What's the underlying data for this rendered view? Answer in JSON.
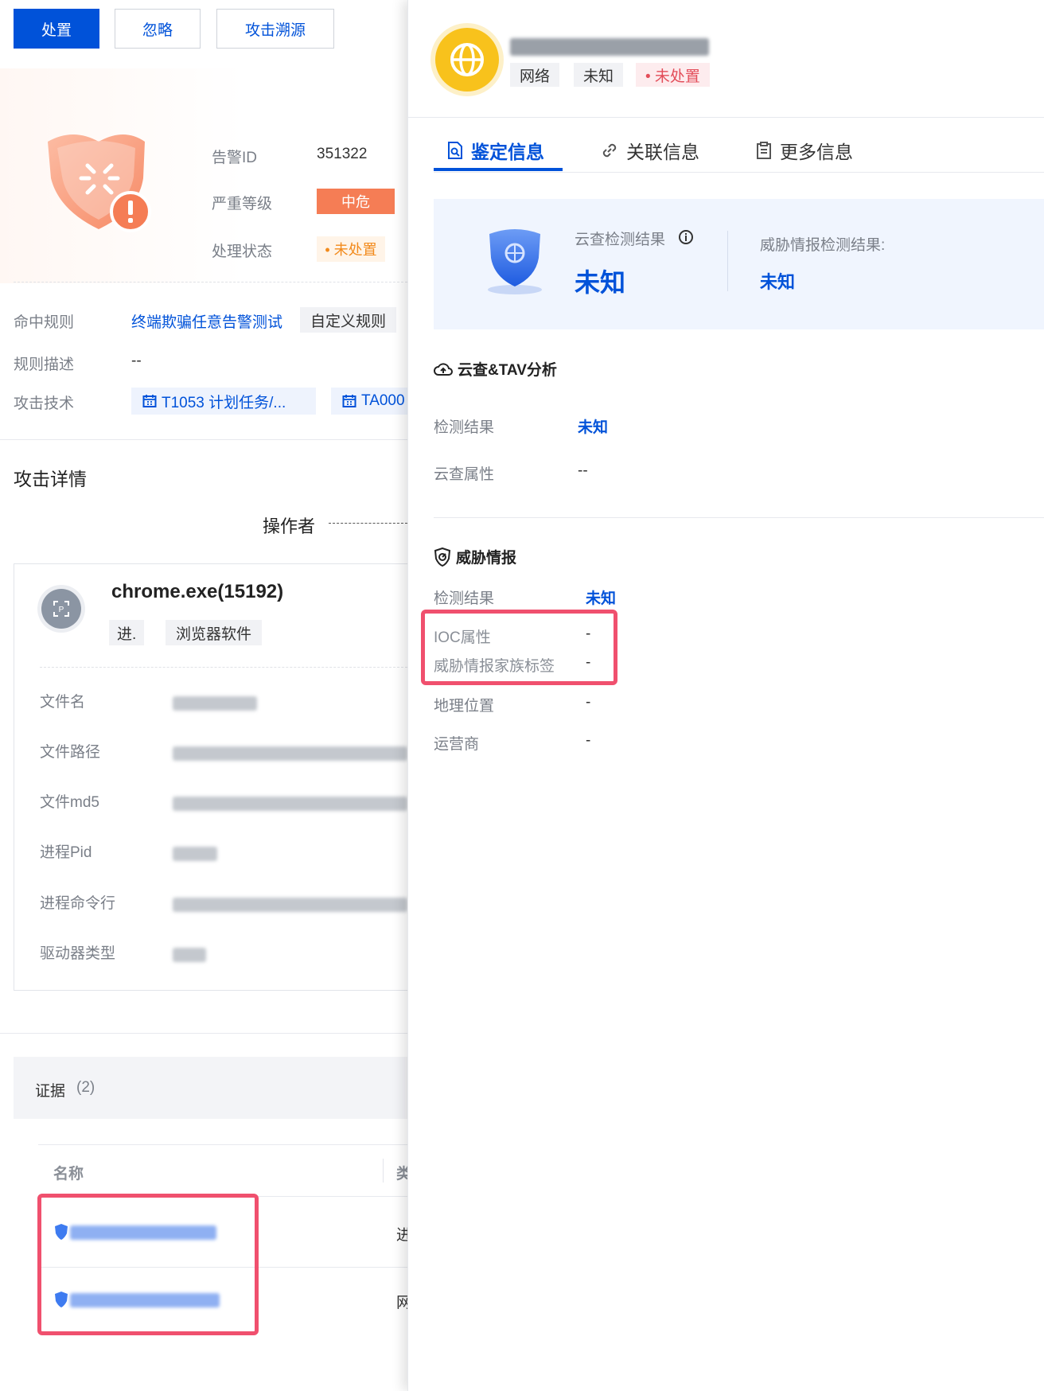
{
  "toolbar": {
    "handle_label": "处置",
    "ignore_label": "忽略",
    "trace_label": "攻击溯源"
  },
  "alert": {
    "id_label": "告警ID",
    "id_value": "351322",
    "severity_label": "严重等级",
    "severity_value": "中危",
    "status_label": "处理状态",
    "status_value": "• 未处置"
  },
  "rule": {
    "hit_label": "命中规则",
    "hit_value": "终端欺骗任意告警测试",
    "hit_tag": "自定义规则",
    "desc_label": "规则描述",
    "desc_value": "--",
    "tech_label": "攻击技术",
    "tech_tags": [
      "T1053 计划任务/...",
      "TA000"
    ]
  },
  "attack": {
    "title": "攻击详情",
    "operator_label": "操作者",
    "process_name": "chrome.exe(15192)",
    "process_tags": [
      "进.",
      "浏览器软件"
    ],
    "fields": [
      {
        "label": "文件名"
      },
      {
        "label": "文件路径"
      },
      {
        "label": "文件md5"
      },
      {
        "label": "进程Pid"
      },
      {
        "label": "进程命令行"
      },
      {
        "label": "驱动器类型"
      }
    ]
  },
  "evidence": {
    "title": "证据",
    "count": "(2)",
    "col_name": "名称",
    "col_type": "类",
    "rows": [
      {
        "type_char": "进"
      },
      {
        "type_char": "网"
      }
    ]
  },
  "entity": {
    "tags": [
      "网络",
      "未知",
      "• 未处置"
    ],
    "icon": "globe-icon"
  },
  "tabs": [
    {
      "label": "鉴定信息",
      "icon": "file-search-icon",
      "active": true
    },
    {
      "label": "关联信息",
      "icon": "link-icon",
      "active": false
    },
    {
      "label": "更多信息",
      "icon": "clipboard-icon",
      "active": false
    }
  ],
  "summary": {
    "cloud_label": "云查检测结果",
    "cloud_value": "未知",
    "intel_label": "威胁情报检测结果:",
    "intel_value": "未知"
  },
  "cloud_section": {
    "title": "云查&TAV分析",
    "result_label": "检测结果",
    "result_value": "未知",
    "attr_label": "云查属性",
    "attr_value": "--"
  },
  "intel_section": {
    "title": "威胁情报",
    "result_label": "检测结果",
    "result_value": "未知",
    "ioc_label": "IOC属性",
    "ioc_value": "-",
    "family_label": "威胁情报家族标签",
    "family_value": "-",
    "geo_label": "地理位置",
    "geo_value": "-",
    "isp_label": "运营商",
    "isp_value": "-"
  },
  "colors": {
    "primary": "#0052d9",
    "danger": "#f57d55",
    "warning": "#f28a1c",
    "highlight_box": "#f0506e",
    "avatar": "#f8c21c"
  }
}
